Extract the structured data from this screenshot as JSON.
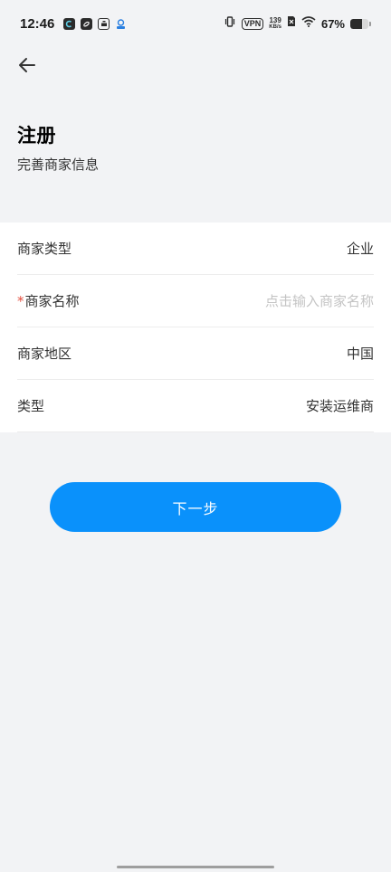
{
  "status_bar": {
    "time": "12:46",
    "vpn": "VPN",
    "net_speed": "139",
    "net_unit": "KB/s",
    "battery": "67%",
    "battery_level": 0.67,
    "app_icons": [
      "c-app-icon",
      "swirl-app-icon",
      "box-app-icon",
      "mascot-app-icon"
    ]
  },
  "header": {
    "back_icon": "arrow-left-icon",
    "title": "注册",
    "subtitle": "完善商家信息"
  },
  "form": {
    "rows": [
      {
        "label": "商家类型",
        "value": "企业",
        "required": false
      },
      {
        "label": "商家名称",
        "value": "",
        "placeholder": "点击输入商家名称",
        "required": true
      },
      {
        "label": "商家地区",
        "value": "中国",
        "required": false
      },
      {
        "label": "类型",
        "value": "安装运维商",
        "required": false
      }
    ],
    "required_mark": "*"
  },
  "actions": {
    "next_label": "下一步"
  },
  "colors": {
    "primary": "#0a91fb",
    "background": "#f2f3f5",
    "required": "#e34d3d",
    "placeholder": "#c4c4c4"
  }
}
